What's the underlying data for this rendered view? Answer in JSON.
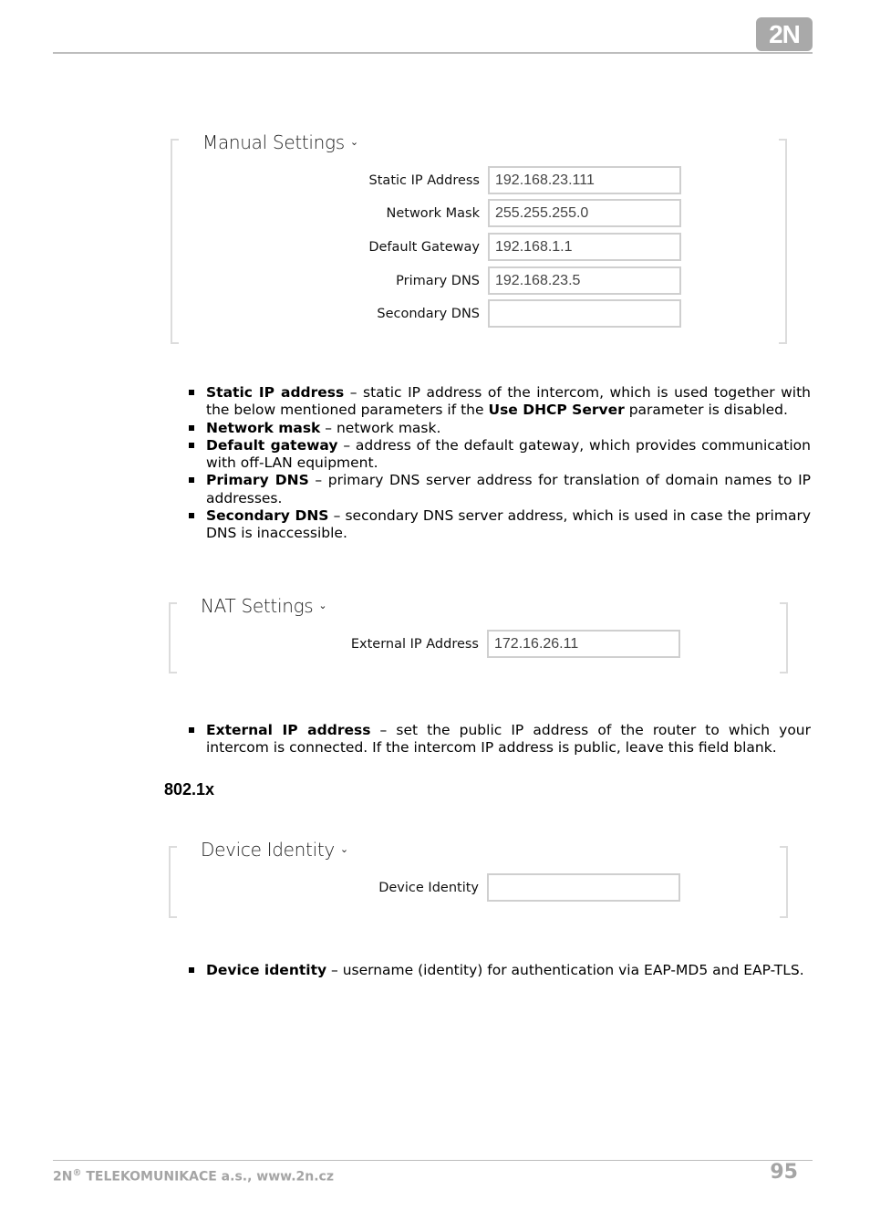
{
  "header": {
    "logo_text": "2N"
  },
  "manual_settings": {
    "title": "Manual Settings",
    "fields": [
      {
        "label": "Static IP Address",
        "value": "192.168.23.111"
      },
      {
        "label": "Network Mask",
        "value": "255.255.255.0"
      },
      {
        "label": "Default Gateway",
        "value": "192.168.1.1"
      },
      {
        "label": "Primary DNS",
        "value": "192.168.23.5"
      },
      {
        "label": "Secondary DNS",
        "value": ""
      }
    ]
  },
  "manual_bullets": [
    {
      "term": "Static IP address",
      "pre": " – static IP address of the intercom, which is used together with the below mentioned parameters if the ",
      "term2": "Use DHCP Server",
      "post": " parameter is disabled."
    },
    {
      "term": "Network mask",
      "pre": " – network mask."
    },
    {
      "term": "Default gateway",
      "pre": " – address of the default gateway, which provides communication with off-LAN equipment."
    },
    {
      "term": "Primary DNS",
      "pre": " – primary DNS server address for translation of domain names to IP addresses."
    },
    {
      "term": "Secondary DNS",
      "pre": " – secondary DNS server address, which is used in case the primary DNS is inaccessible."
    }
  ],
  "nat_settings": {
    "title": "NAT Settings",
    "fields": [
      {
        "label": "External IP Address",
        "value": "172.16.26.11"
      }
    ]
  },
  "nat_bullets": [
    {
      "term": "External IP address",
      "pre": " – set the public IP address of the router to which your intercom is connected. If the intercom IP address is public, leave this field blank."
    }
  ],
  "section_8021x": {
    "heading": "802.1x"
  },
  "device_identity": {
    "title": "Device Identity",
    "fields": [
      {
        "label": "Device Identity",
        "value": ""
      }
    ]
  },
  "device_bullets": [
    {
      "term": "Device identity",
      "pre": " – username (identity) for authentication via EAP-MD5 and EAP-TLS."
    }
  ],
  "footer": {
    "company_prefix": "2N",
    "registered_mark": "®",
    "company_rest": " TELEKOMUNIKACE a.s., www.2n.cz",
    "page_number": "95"
  },
  "icons": {
    "chevron": "⌄"
  }
}
